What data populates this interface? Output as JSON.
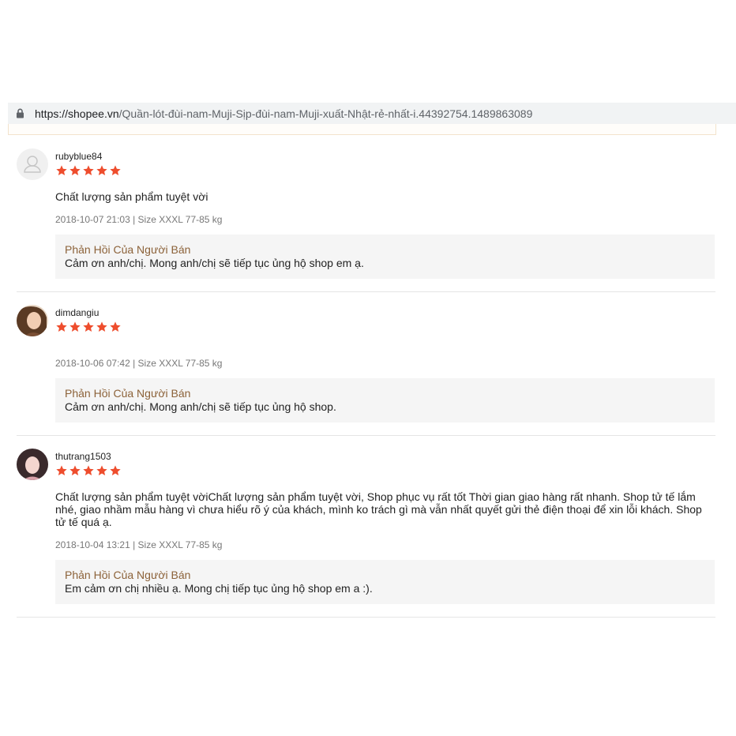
{
  "browser": {
    "url_host": "https://shopee.vn",
    "url_path": "/Quần-lót-đùi-nam-Muji-Sịp-đùi-nam-Muji-xuất-Nhật-rẻ-nhất-i.44392754.1489863089",
    "lock_icon": "lock-icon"
  },
  "colors": {
    "star": "#ee4d2d",
    "reply_title": "#8c6239",
    "reply_bg": "#f5f5f5"
  },
  "reviews": [
    {
      "username": "rubyblue84",
      "rating": 5,
      "avatar": "default-user-icon",
      "comment": " Chất lượng sản phẩm tuyệt vời",
      "meta": "2018-10-07 21:03 | Size XXXL 77-85 kg",
      "reply_title": "Phản Hồi Của Người Bán",
      "reply_text": "Cảm ơn anh/chị. Mong anh/chị sẽ tiếp tục ủng hộ shop em ạ."
    },
    {
      "username": "dimdangiu",
      "rating": 5,
      "avatar": "user-photo",
      "comment": "",
      "meta": "2018-10-06 07:42 | Size XXXL 77-85 kg",
      "reply_title": "Phản Hồi Của Người Bán",
      "reply_text": "Cảm ơn anh/chị. Mong anh/chị sẽ tiếp tục ủng hộ shop."
    },
    {
      "username": "thutrang1503",
      "rating": 5,
      "avatar": "user-photo",
      "comment": " Chất lượng sản phẩm tuyệt vờiChất lượng sản phẩm tuyệt vời, Shop phục vụ rất tốt Thời gian giao hàng rất nhanh. Shop tử tế lắm nhé, giao nhầm mẫu hàng vì chưa hiểu rõ ý của khách, mình ko trách gì mà vẫn nhất quyết gửi thẻ điện thoại để xin lỗi khách. Shop tử tế quá ạ.",
      "meta": "2018-10-04 13:21 | Size XXXL 77-85 kg",
      "reply_title": "Phản Hồi Của Người Bán",
      "reply_text": "Em cảm ơn chị nhiều ạ. Mong chị tiếp tục ủng hộ shop em a :)."
    }
  ]
}
